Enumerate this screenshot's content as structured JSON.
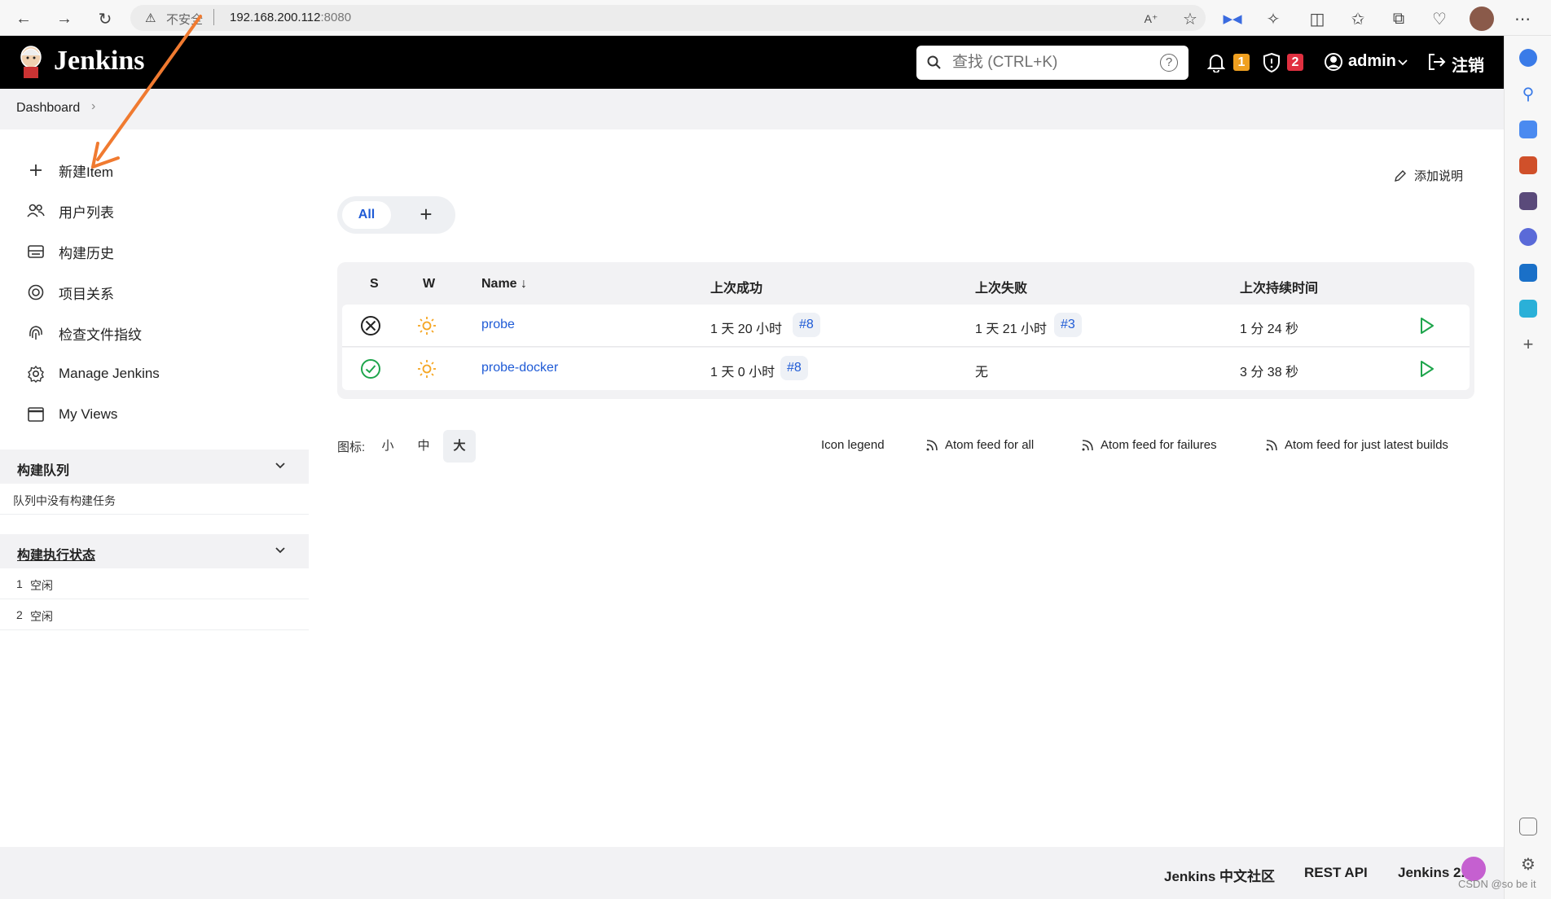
{
  "browser": {
    "security_warning": "不安全",
    "url_host": "192.168.200.112",
    "url_port": ":8080"
  },
  "header": {
    "title": "Jenkins",
    "search_placeholder": "查找 (CTRL+K)",
    "notifications_count": "1",
    "security_count": "2",
    "user": "admin",
    "logout": "注销"
  },
  "breadcrumb": {
    "dashboard": "Dashboard"
  },
  "sidebar": {
    "tasks": [
      {
        "label": "新建Item",
        "icon": "plus-icon"
      },
      {
        "label": "用户列表",
        "icon": "people-icon"
      },
      {
        "label": "构建历史",
        "icon": "history-icon"
      },
      {
        "label": "项目关系",
        "icon": "relation-icon"
      },
      {
        "label": "检查文件指纹",
        "icon": "fingerprint-icon"
      },
      {
        "label": "Manage Jenkins",
        "icon": "gear-icon"
      },
      {
        "label": "My Views",
        "icon": "window-icon"
      }
    ],
    "build_queue": {
      "title": "构建队列",
      "empty": "队列中没有构建任务"
    },
    "executors": {
      "title": "构建执行状态",
      "rows": [
        {
          "num": "1",
          "status": "空闲"
        },
        {
          "num": "2",
          "status": "空闲"
        }
      ]
    }
  },
  "main": {
    "add_description": "添加说明",
    "tabs": {
      "all": "All",
      "add": "+"
    },
    "columns": {
      "s": "S",
      "w": "W",
      "name": "Name ↓",
      "last_success": "上次成功",
      "last_failure": "上次失败",
      "last_duration": "上次持续时间"
    },
    "jobs": [
      {
        "name": "probe",
        "status": "failed",
        "last_success": "1 天 20 小时",
        "last_success_build": "#8",
        "last_failure": "1 天 21 小时",
        "last_failure_build": "#3",
        "duration": "1 分 24 秒"
      },
      {
        "name": "probe-docker",
        "status": "success",
        "last_success": "1 天 0 小时",
        "last_success_build": "#8",
        "last_failure": "无",
        "last_failure_build": "",
        "duration": "3 分 38 秒"
      }
    ],
    "legend": {
      "icon_label": "图标:",
      "sizes": [
        "小",
        "中",
        "大"
      ],
      "icon_legend": "Icon legend",
      "feed_all": "Atom feed for all",
      "feed_failures": "Atom feed for failures",
      "feed_latest": "Atom feed for just latest builds"
    }
  },
  "footer": {
    "community": "Jenkins 中文社区",
    "rest_api": "REST API",
    "version": "Jenkins 2.",
    "watermark": "CSDN @so be it"
  },
  "colors": {
    "header_bg": "#000000",
    "link": "#1f5bd6",
    "notif_badge": "#f0a020",
    "security_badge": "#e03040",
    "success": "#1ea54c",
    "weather": "#f5a623",
    "annotation_arrow": "#f07a30"
  }
}
